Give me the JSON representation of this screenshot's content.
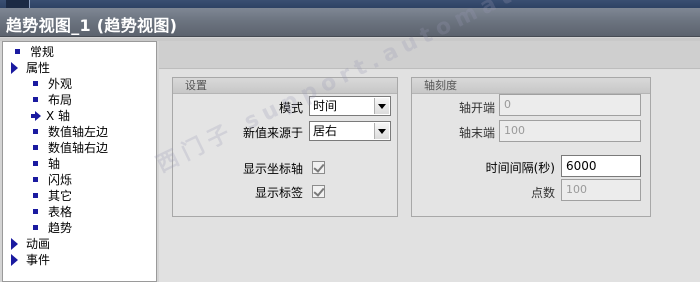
{
  "window": {
    "title": "趋势视图_1 (趋势视图)"
  },
  "tree": {
    "items": [
      {
        "label": "常规",
        "type": "bullet",
        "level": 0
      },
      {
        "label": "属性",
        "type": "expander",
        "level": 0
      },
      {
        "label": "外观",
        "type": "bullet",
        "level": 1
      },
      {
        "label": "布局",
        "type": "bullet",
        "level": 1
      },
      {
        "label": "X 轴",
        "type": "selected",
        "level": 1
      },
      {
        "label": "数值轴左边",
        "type": "bullet",
        "level": 1
      },
      {
        "label": "数值轴右边",
        "type": "bullet",
        "level": 1
      },
      {
        "label": "轴",
        "type": "bullet",
        "level": 1
      },
      {
        "label": "闪烁",
        "type": "bullet",
        "level": 1
      },
      {
        "label": "其它",
        "type": "bullet",
        "level": 1
      },
      {
        "label": "表格",
        "type": "bullet",
        "level": 1
      },
      {
        "label": "趋势",
        "type": "bullet",
        "level": 1
      },
      {
        "label": "动画",
        "type": "expander",
        "level": 0
      },
      {
        "label": "事件",
        "type": "expander",
        "level": 0
      }
    ]
  },
  "settings": {
    "title": "设置",
    "mode_label": "模式",
    "mode_value": "时间",
    "newvalue_label": "新值来源于",
    "newvalue_value": "居右",
    "show_axis_label": "显示坐标轴",
    "show_axis_checked": true,
    "show_tags_label": "显示标签",
    "show_tags_checked": true
  },
  "axis_scale": {
    "title": "轴刻度",
    "axis_start_label": "轴开端",
    "axis_start_value": "0",
    "axis_end_label": "轴末端",
    "axis_end_value": "100",
    "time_interval_label": "时间间隔(秒)",
    "time_interval_value": "6000",
    "points_label": "点数",
    "points_value": "100"
  },
  "watermark": "西门子 support.automation.siemens.com",
  "colors": {
    "tree_bullet": "#1a1aa0",
    "title_bar": "#6c7480"
  }
}
